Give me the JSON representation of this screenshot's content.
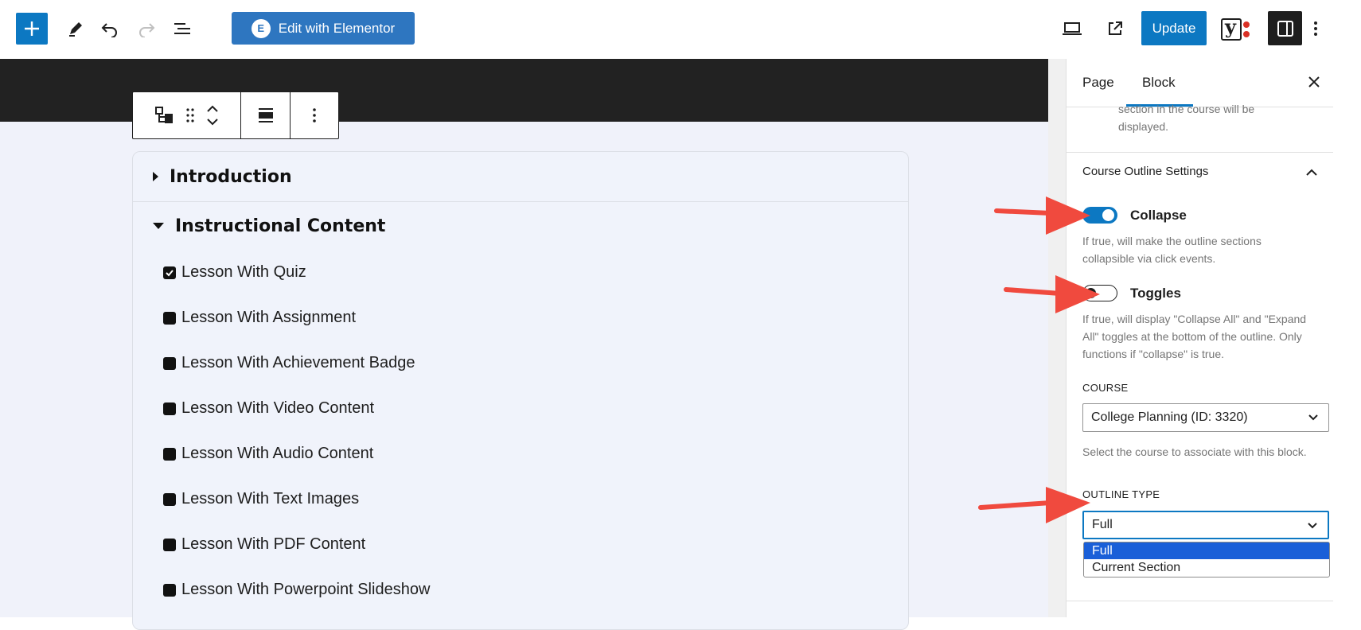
{
  "toolbar": {
    "add_icon": "plus-icon",
    "tools_icon": "pencil-icon",
    "undo_icon": "undo-icon",
    "redo_icon": "redo-icon",
    "list_view_icon": "list-view-icon",
    "elementor_label": "Edit with Elementor",
    "elementor_logo": "E",
    "preview_icon": "desktop-preview-icon",
    "view_post_icon": "external-link-icon",
    "update_label": "Update",
    "yoast_icon": "yoast-icon",
    "yoast_letter": "y",
    "sidebar_icon": "sidebar-toggle-icon",
    "options_icon": "kebab-menu-icon"
  },
  "block_toolbar": {
    "parent_icon": "block-parent-icon",
    "drag_icon": "drag-handle-icon",
    "move_up_icon": "chevron-up-icon",
    "move_down_icon": "chevron-down-icon",
    "align_icon": "align-icon",
    "more_icon": "kebab-menu-icon"
  },
  "outline": {
    "sections": [
      {
        "title": "Introduction",
        "expanded": false
      },
      {
        "title": "Instructional Content",
        "expanded": true
      }
    ],
    "lessons": [
      {
        "title": "Lesson With Quiz",
        "completed": true
      },
      {
        "title": "Lesson With Assignment",
        "completed": false
      },
      {
        "title": "Lesson With Achievement Badge",
        "completed": false
      },
      {
        "title": "Lesson With Video Content",
        "completed": false
      },
      {
        "title": "Lesson With Audio Content",
        "completed": false
      },
      {
        "title": "Lesson With Text Images",
        "completed": false
      },
      {
        "title": "Lesson With PDF Content",
        "completed": false
      },
      {
        "title": "Lesson With Powerpoint Slideshow",
        "completed": false
      }
    ]
  },
  "sidebar": {
    "tabs": [
      {
        "label": "Page",
        "active": false
      },
      {
        "label": "Block",
        "active": true
      }
    ],
    "close_icon": "close-icon",
    "partial_desc_line1": "section in the course will be",
    "partial_desc_line2": "displayed.",
    "panel_title": "Course Outline Settings",
    "panel_chevron": "chevron-up-icon",
    "collapse": {
      "label": "Collapse",
      "checked": true,
      "help_line1": "If true, will make the outline sections",
      "help_line2": "collapsible via click events."
    },
    "toggles": {
      "label": "Toggles",
      "checked": false,
      "help_line1": "If true, will display \"Collapse All\" and \"Expand",
      "help_line2": "All\" toggles at the bottom of the outline. Only",
      "help_line3": "functions if \"collapse\" is true."
    },
    "course": {
      "label": "COURSE",
      "value": "College Planning (ID: 3320)",
      "help": "Select the course to associate with this block."
    },
    "outline_type": {
      "label": "OUTLINE TYPE",
      "value": "Full",
      "options": [
        "Full",
        "Current Section"
      ],
      "highlighted": "Full"
    }
  },
  "colors": {
    "accent": "#0c78c2",
    "dark_header": "#222222",
    "canvas_bg": "#f0f2fa",
    "annotation_arrow": "#f04a3e",
    "dropdown_highlight": "#1a5fd8"
  }
}
